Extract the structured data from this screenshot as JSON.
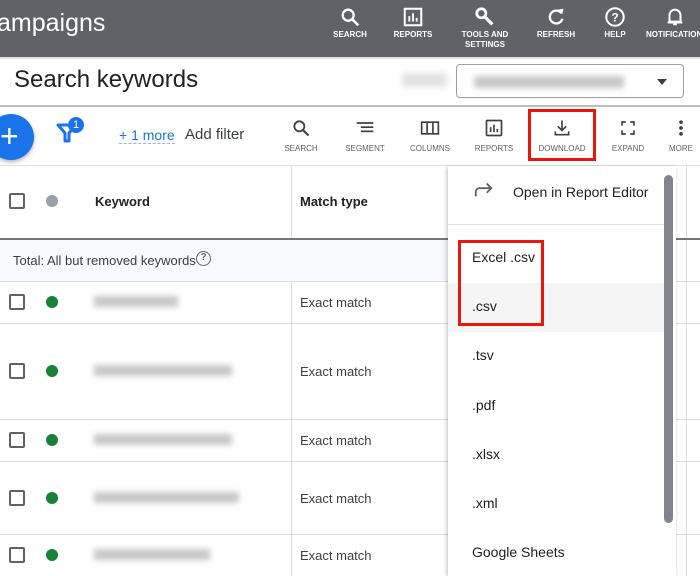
{
  "app": {
    "title": "ampaigns"
  },
  "top_actions": [
    {
      "label": "SEARCH",
      "icon": "search-icon"
    },
    {
      "label": "REPORTS",
      "icon": "reports-icon"
    },
    {
      "label": "TOOLS AND SETTINGS",
      "icon": "wrench-icon"
    },
    {
      "label": "REFRESH",
      "icon": "refresh-icon"
    },
    {
      "label": "HELP",
      "icon": "help-icon"
    },
    {
      "label": "NOTIFICATIONS",
      "icon": "bell-icon"
    }
  ],
  "header": {
    "title": "Search keywords",
    "date_range": "(blurred)"
  },
  "toolbar": {
    "add_label": "+",
    "filter_count": "1",
    "more_filters": "+ 1 more",
    "add_filter": "Add filter",
    "tools": [
      {
        "label": "SEARCH",
        "icon": "search-icon"
      },
      {
        "label": "SEGMENT",
        "icon": "segment-icon"
      },
      {
        "label": "COLUMNS",
        "icon": "columns-icon"
      },
      {
        "label": "REPORTS",
        "icon": "reports-icon"
      },
      {
        "label": "DOWNLOAD",
        "icon": "download-icon"
      },
      {
        "label": "EXPAND",
        "icon": "expand-icon"
      },
      {
        "label": "MORE",
        "icon": "more-vert-icon"
      }
    ]
  },
  "table": {
    "columns": [
      "Keyword",
      "Match type"
    ],
    "total_label": "Total: All but removed keywords",
    "rows": [
      {
        "keyword": "(blurred)",
        "match_type": "Exact match",
        "status": "enabled"
      },
      {
        "keyword": "(blurred)",
        "match_type": "Exact match",
        "status": "enabled"
      },
      {
        "keyword": "(blurred)",
        "match_type": "Exact match",
        "status": "enabled"
      },
      {
        "keyword": "(blurred)",
        "match_type": "Exact match",
        "status": "enabled"
      },
      {
        "keyword": "(blurred)",
        "match_type": "Exact match",
        "status": "enabled"
      }
    ]
  },
  "download_menu": {
    "open_editor": "Open in Report Editor",
    "formats": [
      "Excel .csv",
      ".csv",
      ".tsv",
      ".pdf",
      ".xlsx",
      ".xml",
      "Google Sheets"
    ]
  },
  "colors": {
    "accent": "#1a73e8",
    "topbar": "#5f6368",
    "highlight": "#e8160c",
    "enabled": "#188038"
  }
}
